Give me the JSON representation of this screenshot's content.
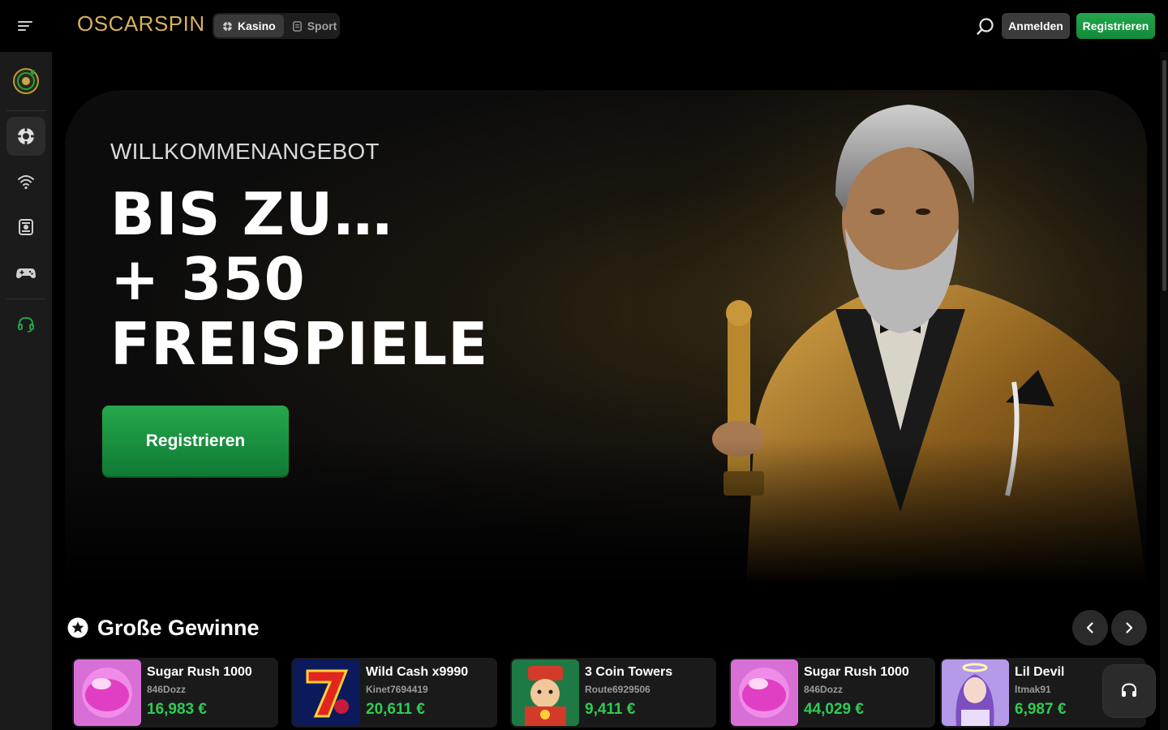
{
  "header": {
    "logo_text": "OSCARSPIN",
    "tabs": [
      {
        "label": "Kasino",
        "active": true,
        "icon": "poker-chip-icon"
      },
      {
        "label": "Sport",
        "active": false,
        "icon": "sport-ticket-icon"
      }
    ],
    "login_label": "Anmelden",
    "register_label": "Registrieren"
  },
  "sidebar": {
    "items": [
      {
        "name": "oscar-chip-icon",
        "active": false
      },
      {
        "name": "casino-chip-icon",
        "active": true
      },
      {
        "name": "live-signal-icon",
        "active": false
      },
      {
        "name": "ticket-icon",
        "active": false
      },
      {
        "name": "gamepad-icon",
        "active": false
      },
      {
        "name": "support-headset-icon",
        "active": false
      }
    ]
  },
  "hero": {
    "subtitle": "WILLKOMMENANGEBOT",
    "line1": "BIS ZU…",
    "line2": "+ 350",
    "line3": "FREISPIELE",
    "cta_label": "Registrieren"
  },
  "big_wins": {
    "title": "Große Gewinne",
    "items": [
      {
        "game": "Sugar Rush 1000",
        "user": "846Dozz",
        "amount": "16,983 €",
        "thumb": "candy"
      },
      {
        "game": "Wild Cash x9990",
        "user": "Kinet7694419",
        "amount": "20,611 €",
        "thumb": "seven"
      },
      {
        "game": "3 Coin Towers",
        "user": "Route6929506",
        "amount": "9,411 €",
        "thumb": "fortune"
      },
      {
        "game": "Sugar Rush 1000",
        "user": "846Dozz",
        "amount": "44,029 €",
        "thumb": "candy"
      },
      {
        "game": "Lil Devil",
        "user": "ltmak91",
        "amount": "6,987 €",
        "thumb": "angel"
      }
    ]
  },
  "colors": {
    "accent_green": "#1f9e47",
    "win_green": "#2ecc55",
    "logo_gold": "#d8b15f"
  }
}
